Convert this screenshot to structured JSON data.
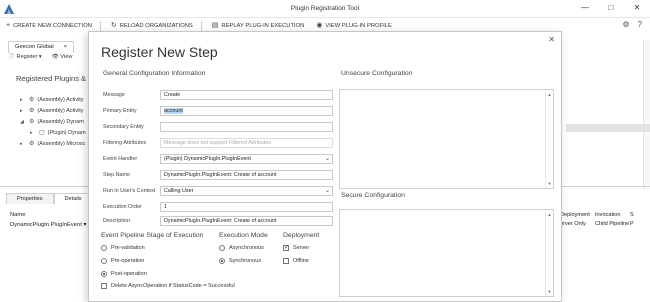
{
  "window": {
    "title": "Plugin Registration Tool"
  },
  "toolbar": {
    "create_connection": "CREATE NEW CONNECTION",
    "reload": "RELOAD ORGANIZATIONS",
    "replay": "REPLAY PLUG-IN EXECUTION",
    "view_profile": "VIEW PLUG-IN PROFILE"
  },
  "left_panel": {
    "tab": "Geecon Global",
    "register": "Register",
    "view": "View",
    "title": "Registered Plugins & C",
    "tree": [
      {
        "label": "(Assembly) Activity",
        "indent": false,
        "caret": "▸"
      },
      {
        "label": "(Assembly) Activity",
        "indent": false,
        "caret": "▸"
      },
      {
        "label": "(Assembly) Dynam",
        "indent": false,
        "caret": "◢"
      },
      {
        "label": "(Plugin) Dynam",
        "indent": true,
        "caret": "▸"
      },
      {
        "label": "(Assembly) Microsc",
        "indent": false,
        "caret": "▸"
      }
    ]
  },
  "bottom": {
    "tabs": [
      "Properties",
      "Details"
    ],
    "grid_header": "Name",
    "grid_row": "DynamicPlugIn.PlugInEvent",
    "right_header": [
      "Deployment",
      "Invocation",
      "S"
    ],
    "right_row": [
      "erver Only",
      "Child Pipeline",
      "P"
    ]
  },
  "dialog": {
    "title": "Register New Step",
    "general_header": "General Configuration Information",
    "unsecure_header": "Unsecure  Configuration",
    "secure_header": "Secure  Configuration",
    "fields": {
      "message": {
        "label": "Message",
        "value": "Create"
      },
      "primary_entity": {
        "label": "Primary Entity",
        "value": "account"
      },
      "secondary_entity": {
        "label": "Secondary Entity",
        "value": ""
      },
      "filtering_attributes": {
        "label": "Filtering Attributes",
        "value": "Message does not support Filtered Attributes"
      },
      "event_handler": {
        "label": "Event Handler",
        "value": "(Plugin) DynamicPlugIn.PlugInEvent"
      },
      "step_name": {
        "label": "Step Name",
        "value": "DynamicPlugIn.PlugInEvent: Create of account"
      },
      "run_in_context": {
        "label": "Run in User's Context",
        "value": "Calling User"
      },
      "execution_order": {
        "label": "Execution Order",
        "value": "1"
      },
      "description": {
        "label": "Description",
        "value": "DynamicPlugIn.PlugInEvent: Create of account"
      }
    },
    "pipeline": {
      "header": "Event Pipeline Stage of Execution",
      "options": [
        "Pre-validation",
        "Pre-operation",
        "Post-operation"
      ],
      "selected": "Post-operation",
      "delete_async": "Delete AsyncOperation if StatusCode = Successful"
    },
    "execution_mode": {
      "header": "Execution Mode",
      "options": [
        "Asynchronous",
        "Synchronous"
      ],
      "selected": "Synchronous"
    },
    "deployment": {
      "header": "Deployment",
      "server": "Server",
      "server_checked": true,
      "offline": "Offline",
      "offline_checked": false
    }
  }
}
